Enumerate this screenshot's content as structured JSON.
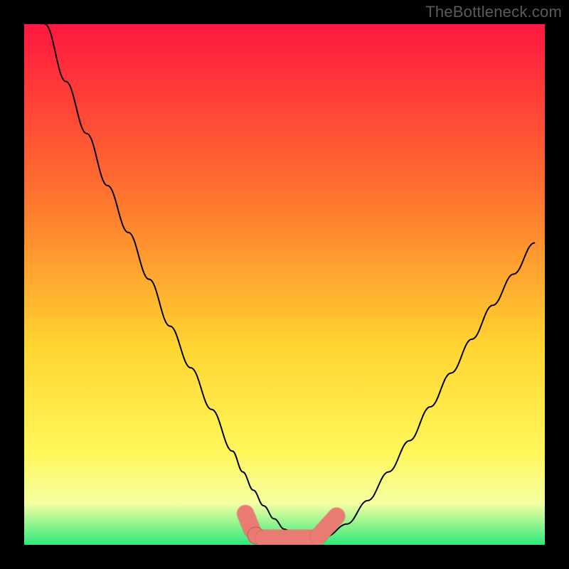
{
  "watermark": "TheBottleneck.com",
  "colors": {
    "bg_black": "#000000",
    "grad_top": "#ff173f",
    "grad_mid1": "#ff7a2e",
    "grad_mid2": "#ffd531",
    "grad_lower": "#fff75a",
    "grad_pale": "#f6ffa2",
    "grad_bottom": "#2fe97b",
    "curve": "#000000",
    "marker_fill": "#e97b72",
    "marker_stroke": "#c85a53"
  },
  "gradient_stops": [
    {
      "offset": 0.0,
      "key": "grad_top"
    },
    {
      "offset": 0.35,
      "key": "grad_mid1"
    },
    {
      "offset": 0.62,
      "key": "grad_mid2"
    },
    {
      "offset": 0.82,
      "key": "grad_lower"
    },
    {
      "offset": 0.92,
      "key": "grad_pale"
    },
    {
      "offset": 1.0,
      "key": "grad_bottom"
    }
  ],
  "chart_data": {
    "type": "line",
    "title": "",
    "xlabel": "",
    "ylabel": "",
    "xlim": [
      0,
      100
    ],
    "ylim": [
      0,
      100
    ],
    "grid": false,
    "legend": false,
    "series": [
      {
        "name": "bottleneck-curve",
        "x": [
          4,
          8,
          12,
          16,
          20,
          24,
          28,
          32,
          36,
          40,
          42,
          44,
          46,
          48,
          50,
          52,
          54,
          56,
          58,
          62,
          66,
          70,
          74,
          78,
          82,
          86,
          90,
          94,
          98
        ],
        "values": [
          100,
          89,
          79,
          69,
          60,
          51,
          42,
          34,
          26,
          18,
          14,
          10.5,
          7.5,
          5,
          3,
          1.6,
          1,
          1,
          1.6,
          4,
          8.5,
          14,
          20,
          26.5,
          33,
          39.5,
          46,
          52,
          58
        ]
      }
    ],
    "markers": [
      {
        "shape": "capsule",
        "x0": 42.5,
        "y0": 6.0,
        "x1": 43.7,
        "y1": 3.0,
        "r": 1.6
      },
      {
        "shape": "circle",
        "cx": 44.5,
        "cy": 1.8,
        "r": 1.6
      },
      {
        "shape": "capsule",
        "x0": 46.0,
        "y0": 1.25,
        "x1": 55.0,
        "y1": 1.25,
        "r": 1.6
      },
      {
        "shape": "capsule",
        "x0": 56.5,
        "y0": 1.6,
        "x1": 60.0,
        "y1": 5.5,
        "r": 1.6
      }
    ]
  }
}
